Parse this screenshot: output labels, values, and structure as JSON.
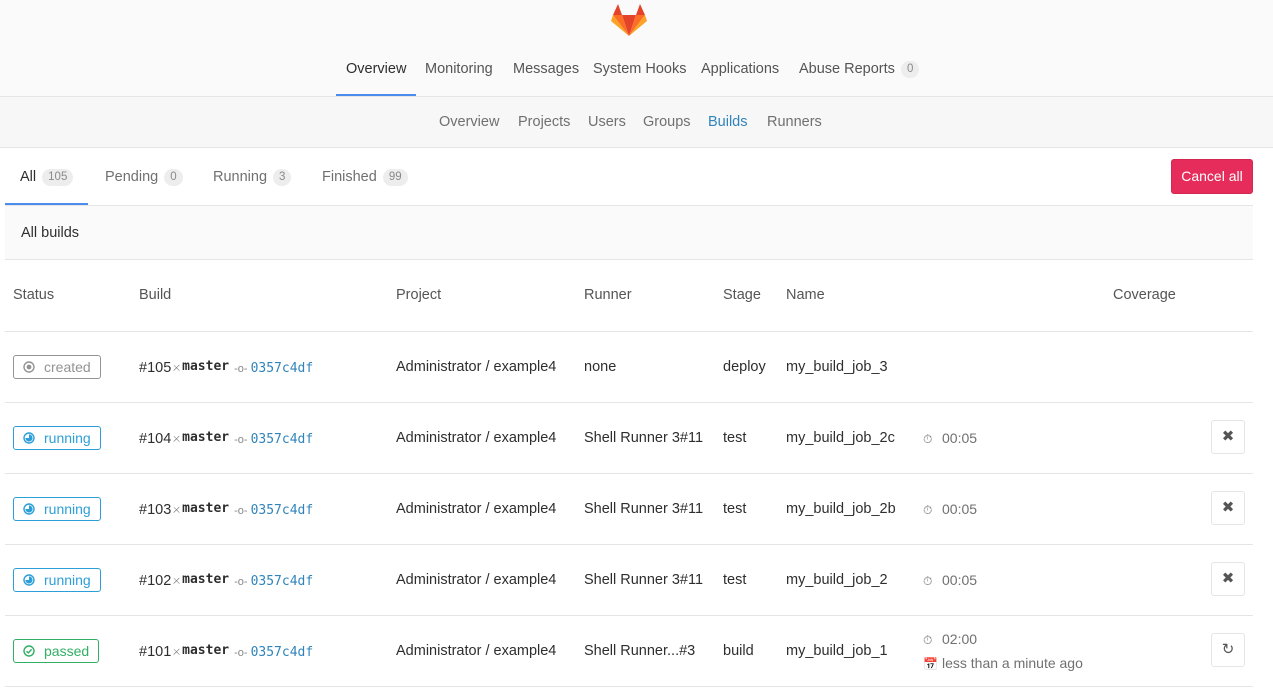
{
  "header": {
    "logo": "gitlab-tanuki-logo",
    "nav": [
      {
        "label": "Overview",
        "active": true
      },
      {
        "label": "Monitoring"
      },
      {
        "label": "Messages"
      },
      {
        "label": "System Hooks"
      },
      {
        "label": "Applications"
      },
      {
        "label": "Abuse Reports",
        "badge": "0"
      }
    ]
  },
  "subnav": [
    {
      "label": "Overview"
    },
    {
      "label": "Projects"
    },
    {
      "label": "Users"
    },
    {
      "label": "Groups"
    },
    {
      "label": "Builds",
      "active": true
    },
    {
      "label": "Runners"
    }
  ],
  "tabs": [
    {
      "label": "All",
      "count": "105",
      "active": true
    },
    {
      "label": "Pending",
      "count": "0"
    },
    {
      "label": "Running",
      "count": "3"
    },
    {
      "label": "Finished",
      "count": "99"
    }
  ],
  "cancel_all_label": "Cancel all",
  "section_title": "All builds",
  "table": {
    "columns": [
      "Status",
      "Build",
      "Project",
      "Runner",
      "Stage",
      "Name",
      "Coverage"
    ],
    "rows": [
      {
        "status": "created",
        "build": "#105",
        "branch": "master",
        "sha": "0357c4df",
        "project": "Administrator / example4",
        "runner": "none",
        "stage": "deploy",
        "name": "my_build_job_3",
        "duration": "",
        "finished": "",
        "action": ""
      },
      {
        "status": "running",
        "build": "#104",
        "branch": "master",
        "sha": "0357c4df",
        "project": "Administrator / example4",
        "runner": "Shell Runner 3#11",
        "stage": "test",
        "name": "my_build_job_2c",
        "duration": "00:05",
        "finished": "",
        "action": "cancel"
      },
      {
        "status": "running",
        "build": "#103",
        "branch": "master",
        "sha": "0357c4df",
        "project": "Administrator / example4",
        "runner": "Shell Runner 3#11",
        "stage": "test",
        "name": "my_build_job_2b",
        "duration": "00:05",
        "finished": "",
        "action": "cancel"
      },
      {
        "status": "running",
        "build": "#102",
        "branch": "master",
        "sha": "0357c4df",
        "project": "Administrator / example4",
        "runner": "Shell Runner 3#11",
        "stage": "test",
        "name": "my_build_job_2",
        "duration": "00:05",
        "finished": "",
        "action": "cancel"
      },
      {
        "status": "passed",
        "build": "#101",
        "branch": "master",
        "sha": "0357c4df",
        "project": "Administrator / example4",
        "runner": "Shell Runner...#3",
        "stage": "build",
        "name": "my_build_job_1",
        "duration": "02:00",
        "finished": "less than a minute ago",
        "action": "retry"
      }
    ]
  },
  "colors": {
    "active_nav": "#4a8bee",
    "link": "#3084bb",
    "danger": "#e52c5a",
    "created": "#939393",
    "running": "#2d9fd8",
    "passed": "#31af64"
  }
}
